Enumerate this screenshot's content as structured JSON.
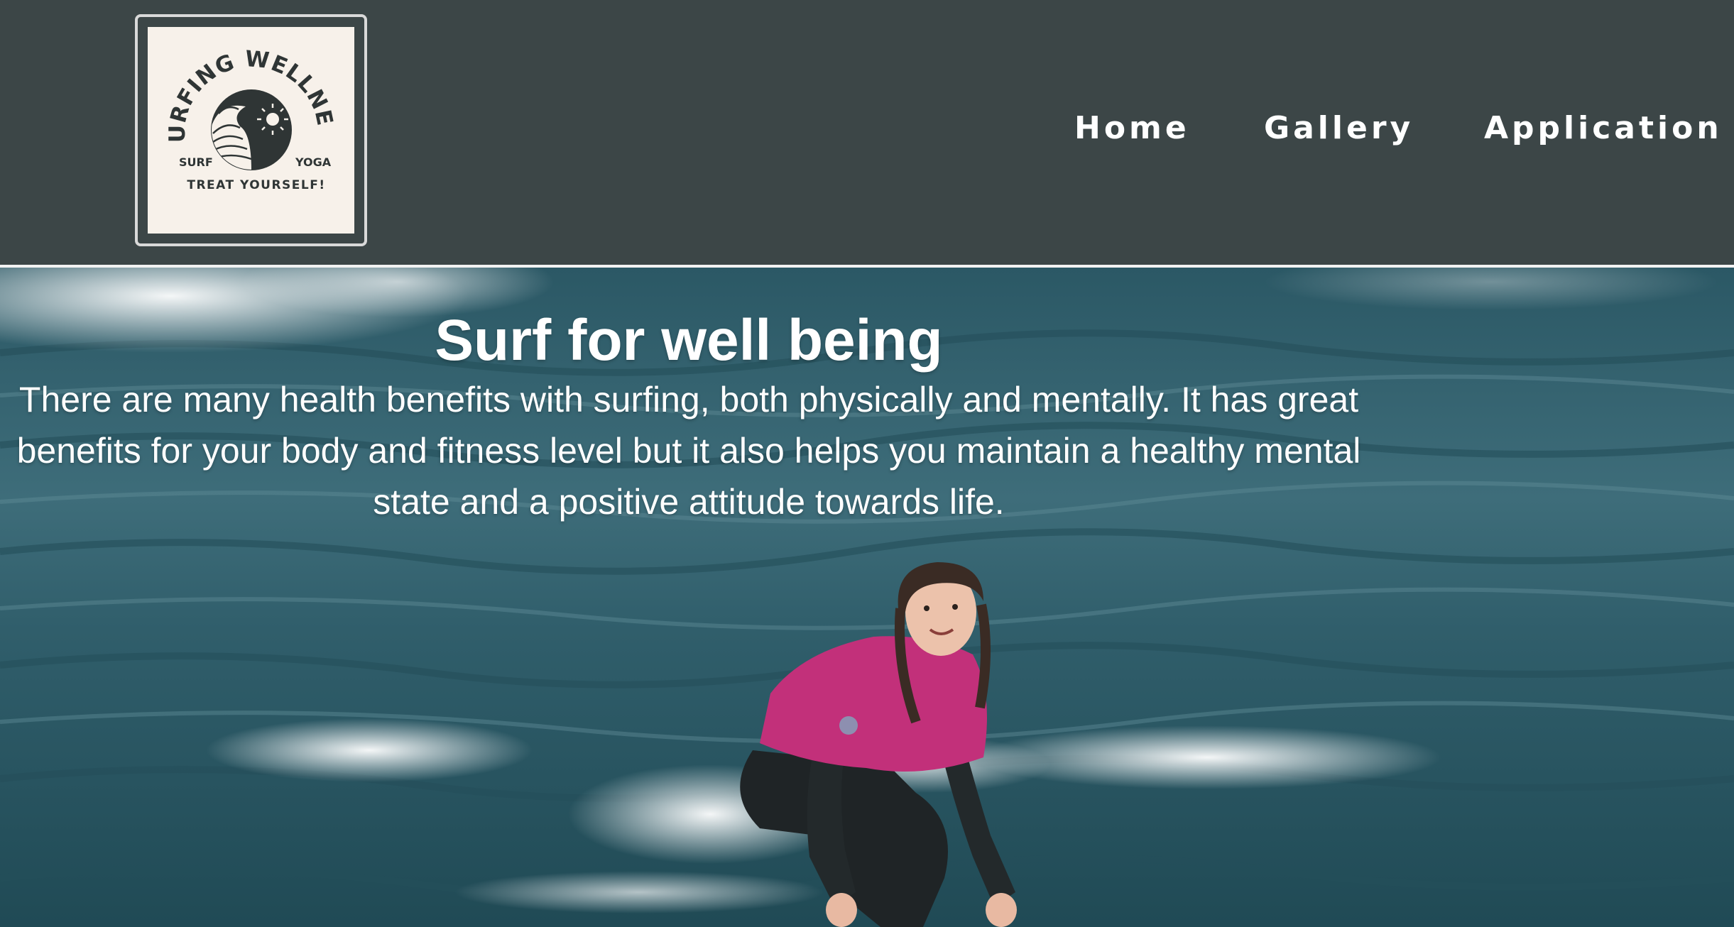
{
  "logo": {
    "arc_text": "SURFING WELLNESS",
    "left_text": "SURF",
    "right_text": "YOGA",
    "tagline": "TREAT YOURSELF!"
  },
  "nav": {
    "items": [
      {
        "label": "Home"
      },
      {
        "label": "Gallery"
      },
      {
        "label": "Application"
      }
    ]
  },
  "hero": {
    "title": "Surf for well being",
    "body": "There are many health benefits with surfing, both physically and mentally. It has great benefits for your body and fitness level but it also helps you maintain a healthy mental state and a positive attitude towards life."
  },
  "colors": {
    "header_bg": "#3c4647",
    "logo_bg": "#f7f1ea",
    "text": "#ffffff",
    "rash_guard": "#c2307a"
  }
}
